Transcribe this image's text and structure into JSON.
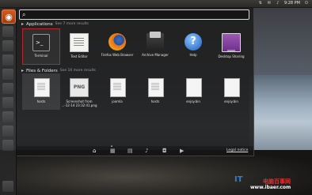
{
  "top_panel": {
    "time": "9:28 PM"
  },
  "search": {
    "value": "",
    "placeholder": ""
  },
  "applications": {
    "title": "Applications",
    "more": "See 7 more results",
    "items": [
      {
        "label": "Terminal",
        "icon": "terminal-icon",
        "selected": true
      },
      {
        "label": "Text Editor",
        "icon": "text-editor-icon"
      },
      {
        "label": "Firefox Web Browser",
        "icon": "firefox-icon"
      },
      {
        "label": "Archive Manager",
        "icon": "archive-icon"
      },
      {
        "label": "Help",
        "icon": "help-icon"
      },
      {
        "label": "Desktop Sharing",
        "icon": "desktop-sharing-icon"
      }
    ]
  },
  "files": {
    "title": "Files & Folders",
    "more": "See 16 more results",
    "items": [
      {
        "label": "hosts",
        "icon": "document-icon"
      },
      {
        "label": "Screenshot from",
        "label2": "...-12-14 23:32:41.png",
        "icon_text": "PNG",
        "icon": "png-icon"
      },
      {
        "label": "joomla",
        "icon": "document-icon"
      },
      {
        "label": "hosts",
        "icon": "document-icon"
      },
      {
        "label": "enjoy.bin",
        "icon": "binary-icon"
      },
      {
        "label": "enjoy.bin",
        "icon": "binary-icon"
      }
    ]
  },
  "lenses": {
    "legal_notice": "Legal notice"
  },
  "watermark": {
    "logo": "IT",
    "line1": "电脑百事网",
    "line2": "www.ibaer.com"
  },
  "colors": {
    "selection_border": "#b4272a",
    "launcher_bfb": "#d35b1f"
  }
}
